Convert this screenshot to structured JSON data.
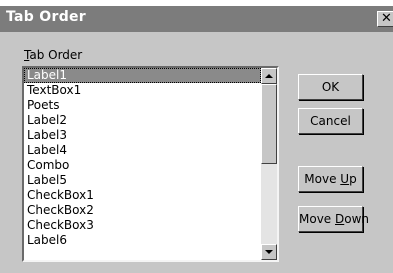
{
  "window": {
    "title": "Tab Order",
    "close_glyph": "✕"
  },
  "group_label": {
    "mnemonic": "T",
    "rest": "ab Order"
  },
  "list": {
    "items": [
      "Label1",
      "TextBox1",
      "Poets",
      "Label2",
      "Label3",
      "Label4",
      "Combo",
      "Label5",
      "CheckBox1",
      "CheckBox2",
      "CheckBox3",
      "Label6"
    ],
    "selected_index": 0
  },
  "buttons": {
    "ok": "OK",
    "cancel": "Cancel",
    "move_up": {
      "before": "Move ",
      "mnemonic": "U",
      "after": "p"
    },
    "move_down": {
      "before": "Move ",
      "mnemonic": "D",
      "after": "own"
    }
  },
  "colors": {
    "title_bar": "#7c7c7c",
    "dialog_face": "#c6c6c6",
    "selection": "#8a8a8a"
  },
  "icons": {
    "close": "close-icon",
    "scroll_up": "arrow-up-icon",
    "scroll_down": "arrow-down-icon"
  }
}
